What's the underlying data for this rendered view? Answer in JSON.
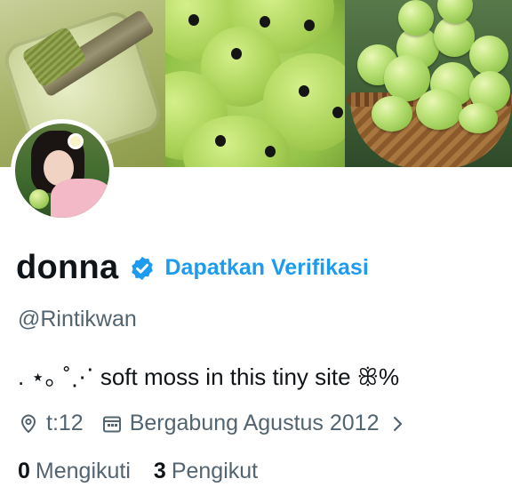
{
  "profile": {
    "display_name": "donna",
    "verify_link": "Dapatkan Verifikasi",
    "handle": "@Rintikwan",
    "bio": ". ⋆｡ ˚⋰ soft moss in this tiny site ꕥ%",
    "location": "t:12",
    "joined": "Bergabung Agustus 2012"
  },
  "stats": {
    "following_count": "0",
    "following_label": "Mengikuti",
    "followers_count": "3",
    "followers_label": "Pengikut"
  },
  "icons": {
    "verified": "verified-badge-icon",
    "location": "location-pin-icon",
    "calendar": "calendar-icon",
    "chevron": "chevron-right-icon"
  },
  "colors": {
    "accent": "#1d9bf0",
    "text": "#0f1419",
    "muted": "#536471"
  }
}
